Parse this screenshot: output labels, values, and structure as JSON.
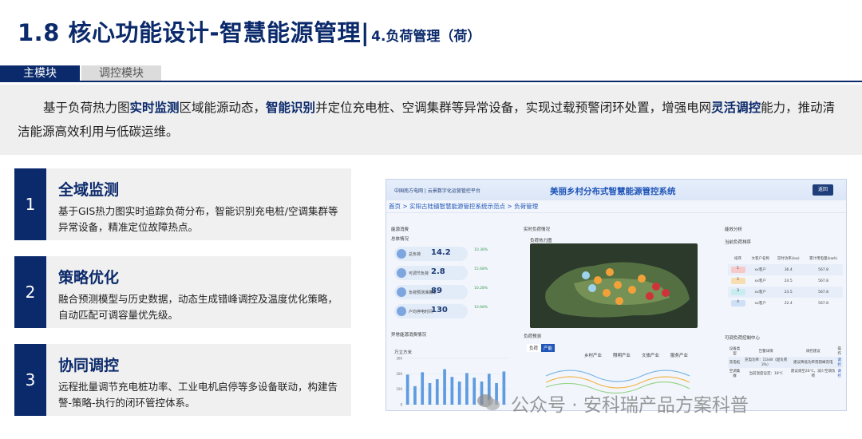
{
  "header": {
    "title": "1.8 核心功能设计-智慧能源管理|",
    "subtitle": "4.负荷管理（荷）"
  },
  "tabs": [
    {
      "label": "主模块",
      "active": true
    },
    {
      "label": "调控模块",
      "active": false
    }
  ],
  "intro": {
    "p1": "基于负荷热力图",
    "k1": "实时监测",
    "p2": "区域能源动态，",
    "k2": "智能识别",
    "p3": "并定位充电桩、空调集群等异常设备，实现过载预警闭环处置，增强电网",
    "k3": "灵活调控",
    "p4": "能力，推动清洁能源高效利用与低碳运维。"
  },
  "cards": [
    {
      "num": "1",
      "title": "全域监测",
      "desc": "基于GIS热力图实时追踪负荷分布，智能识别充电桩/空调集群等异常设备，精准定位故障热点。"
    },
    {
      "num": "2",
      "title": "策略优化",
      "desc": "融合预测模型与历史数据，动态生成错峰调控及温度优化策略，自动匹配可调容量优先级。"
    },
    {
      "num": "3",
      "title": "协同调控",
      "desc": "远程批量调节充电桩功率、工业电机启停等多设备联动，构建告警-策略-执行的闭环管控体系。"
    }
  ],
  "screenshot": {
    "logo_text": "中国南方电网 | 云景数字化运营管控平台",
    "platform_title": "美丽乡村分布式智慧能源管控系统",
    "back_label": "返回",
    "breadcrumb": "首页 > 实阳古陆镇智慧能源管控系统示范点 > 负荷管理",
    "left_title": "能源消费",
    "left_sub": "总体情况",
    "kpis": [
      {
        "label": "总负荷",
        "value": "14.2",
        "delta": "10.38%"
      },
      {
        "label": "可调节负荷",
        "value": "2.8",
        "delta": "15.68%"
      },
      {
        "label": "负荷预测准确率",
        "value": "89",
        "delta": "10.28%"
      },
      {
        "label": "户均停电时间",
        "value": "130",
        "delta": "10.68%"
      }
    ],
    "energy_trend_title": "异常能源消费情况",
    "chart_unit": "万立方米",
    "mid_title": "实时负荷情况",
    "map_title": "负荷热力图",
    "forecast_title": "负荷预测",
    "forecast_tabs": [
      "负荷",
      "产能"
    ],
    "forecast_legend": [
      "乡村产业",
      "照明产业",
      "文旅产业",
      "服务产业"
    ],
    "right_title": "能效分析",
    "right_sub": "当前负荷排序",
    "table_headers": [
      "排序",
      "大客户名称",
      "实时功率(kw)",
      "累计用电量(kwh)"
    ],
    "table_rows": [
      {
        "rank": "1",
        "name": "xx客户",
        "power": "36.4",
        "total": "567.8"
      },
      {
        "rank": "2",
        "name": "xx客户",
        "power": "24.5",
        "total": "567.8"
      },
      {
        "rank": "3",
        "name": "xx客户",
        "power": "23.5",
        "total": "567.8"
      },
      {
        "rank": "4",
        "name": "xx客户",
        "power": "22.4",
        "total": "567.8"
      }
    ],
    "control_title": "可调负荷控制中心",
    "control_headers": [
      "设备类型",
      "告警详情",
      "调控建议",
      "操作"
    ],
    "control_rows": [
      {
        "type": "充电桩",
        "detail": "充电功率：11kW（超负荷3%）",
        "advice": "建议降低功率或错峰充电",
        "op": "调控"
      },
      {
        "type": "空调集群",
        "detail": "当前温度设定：18℃",
        "advice": "建议调至26℃，减少空调负荷",
        "op": "调控"
      }
    ]
  },
  "watermark": "公众号 · 安科瑞产品方案科普",
  "colors": {
    "brand": "#0b2a6b",
    "panel": "#f0f0f0"
  },
  "chart_data": {
    "type": "bar",
    "values": [
      195,
      120,
      210,
      140,
      165,
      230,
      180,
      150,
      205,
      175,
      150,
      200,
      140,
      215
    ],
    "ylim": [
      0,
      300
    ]
  }
}
